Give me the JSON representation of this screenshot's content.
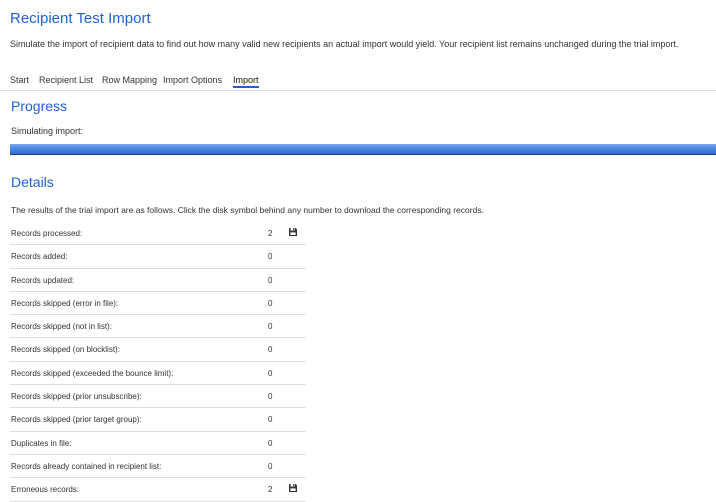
{
  "page": {
    "title": "Recipient Test Import",
    "intro": "Simulate the import of recipient data to find out how many valid new recipients an actual import would yield. Your recipient list remains unchanged during the trial import."
  },
  "tabs": [
    {
      "label": "Start"
    },
    {
      "label": "Recipient List"
    },
    {
      "label": "Row Mapping"
    },
    {
      "label": "Import Options"
    },
    {
      "label": "Import",
      "active": true
    }
  ],
  "progress": {
    "heading": "Progress",
    "label": "Simulating import:",
    "percent": 100
  },
  "details": {
    "heading": "Details",
    "description": "The results of the trial import are as follows. Click the disk symbol behind any number to download the corresponding records.",
    "download_icon": "disk-icon",
    "rows": [
      {
        "label": "Records processed:",
        "value": "2",
        "download": true
      },
      {
        "label": "Records added:",
        "value": "0",
        "download": false
      },
      {
        "label": "Records updated:",
        "value": "0",
        "download": false
      },
      {
        "label": "Records skipped (error in file):",
        "value": "0",
        "download": false
      },
      {
        "label": "Records skipped (not in list):",
        "value": "0",
        "download": false
      },
      {
        "label": "Records skipped (on blocklist):",
        "value": "0",
        "download": false
      },
      {
        "label": "Records skipped (exceeded the bounce limit):",
        "value": "0",
        "download": false
      },
      {
        "label": "Records skipped (prior unsubscribe):",
        "value": "0",
        "download": false
      },
      {
        "label": "Records skipped (prior target group):",
        "value": "0",
        "download": false
      },
      {
        "label": "Duplicates in file:",
        "value": "0",
        "download": false
      },
      {
        "label": "Records already contained in recipient list:",
        "value": "0",
        "download": false
      },
      {
        "label": "Erroneous records:",
        "value": "2",
        "download": true
      }
    ]
  },
  "colors": {
    "accent": "#1f5fd6",
    "progress_fill": "#4f86e3",
    "divider": "#dddddd"
  }
}
